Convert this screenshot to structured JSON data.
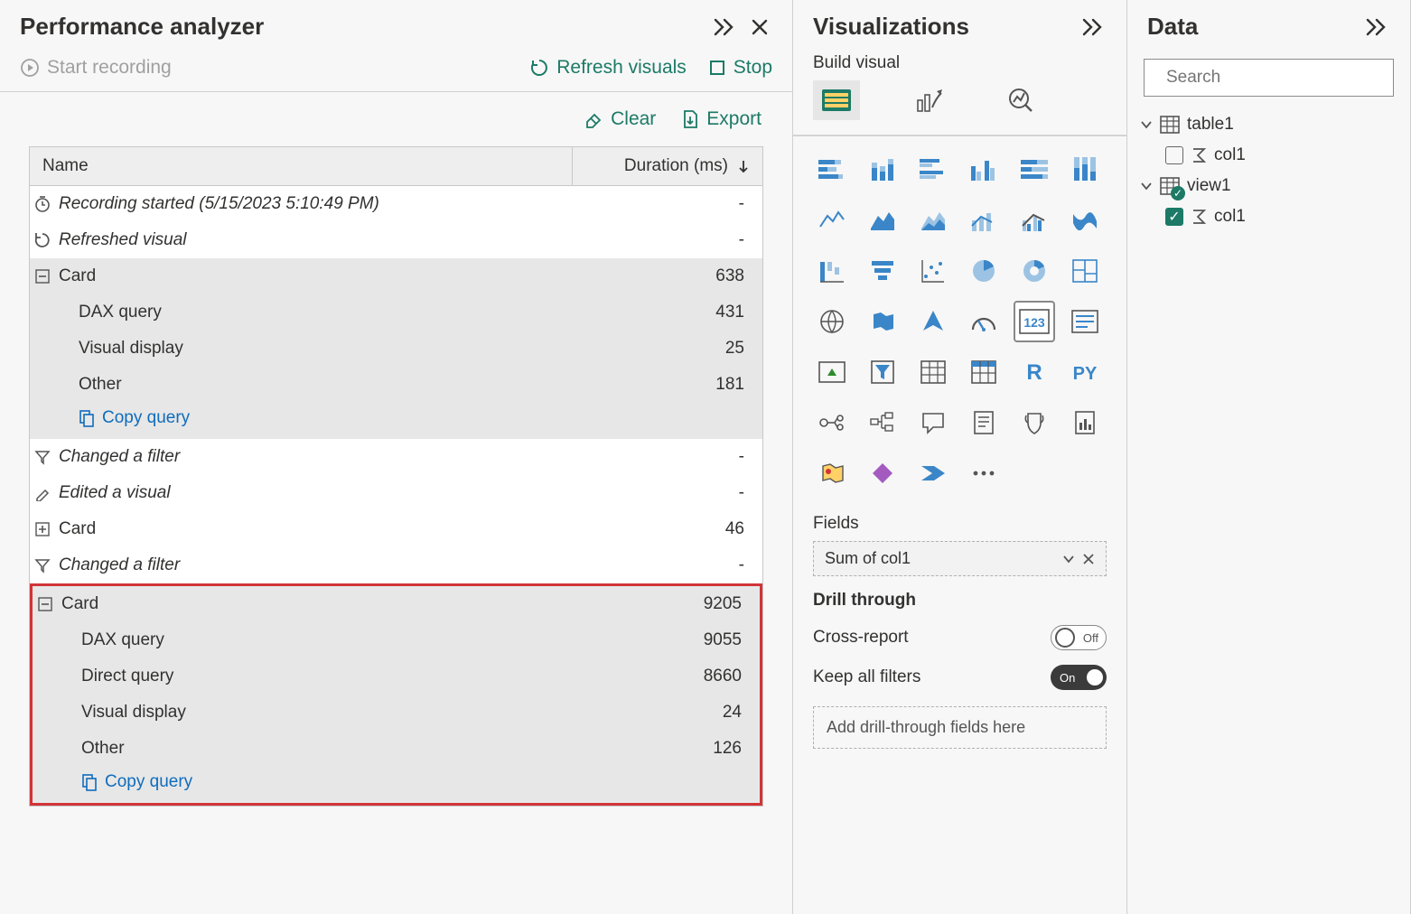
{
  "perf": {
    "title": "Performance analyzer",
    "start_recording": "Start recording",
    "refresh_visuals": "Refresh visuals",
    "stop": "Stop",
    "clear": "Clear",
    "export": "Export",
    "col_name": "Name",
    "col_duration": "Duration (ms)",
    "copy_query": "Copy query",
    "rows": {
      "recording_started": "Recording started (5/15/2023 5:10:49 PM)",
      "refreshed_visual": "Refreshed visual",
      "card1": "Card",
      "card1_dur": "638",
      "dax1": "DAX query",
      "dax1_dur": "431",
      "vis1": "Visual display",
      "vis1_dur": "25",
      "oth1": "Other",
      "oth1_dur": "181",
      "changed_filter1": "Changed a filter",
      "edited_visual": "Edited a visual",
      "card2": "Card",
      "card2_dur": "46",
      "changed_filter2": "Changed a filter",
      "card3": "Card",
      "card3_dur": "9205",
      "dax3": "DAX query",
      "dax3_dur": "9055",
      "dq3": "Direct query",
      "dq3_dur": "8660",
      "vis3": "Visual display",
      "vis3_dur": "24",
      "oth3": "Other",
      "oth3_dur": "126"
    }
  },
  "viz": {
    "title": "Visualizations",
    "build_visual": "Build visual",
    "fields_label": "Fields",
    "field_value": "Sum of col1",
    "drill_through": "Drill through",
    "cross_report": "Cross-report",
    "cross_report_state": "Off",
    "keep_filters": "Keep all filters",
    "keep_filters_state": "On",
    "drill_placeholder": "Add drill-through fields here"
  },
  "data": {
    "title": "Data",
    "search_placeholder": "Search",
    "table1": "table1",
    "col1a": "col1",
    "view1": "view1",
    "col1b": "col1"
  }
}
